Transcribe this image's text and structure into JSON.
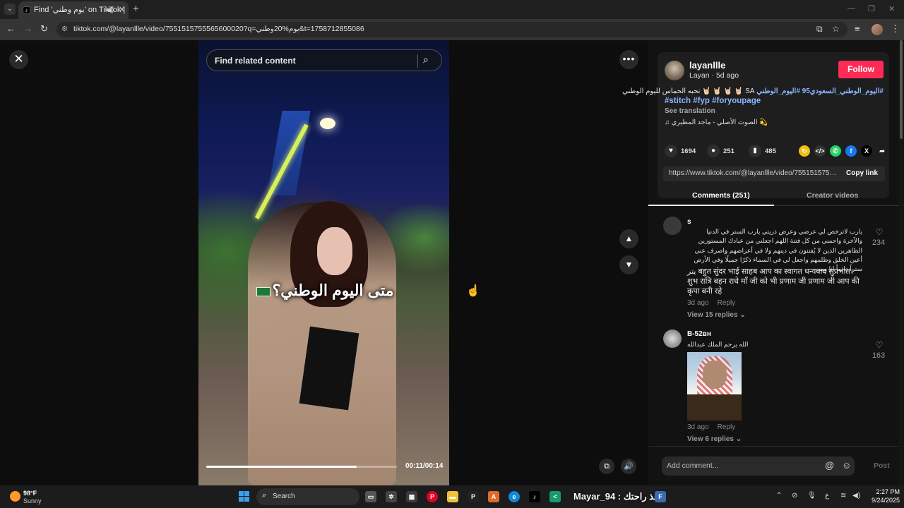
{
  "browser": {
    "tab_title": "Find 'يوم وطني' on TikTok |",
    "url": "tiktok.com/@layanllle/video/7551515755565600020?q=يوم%20وطني&t=1758712855086"
  },
  "video": {
    "search_placeholder": "Find related content",
    "caption": "متى اليوم الوطني؟",
    "time": "00:11/00:14",
    "progress_percent": 79
  },
  "author": {
    "username": "layanllle",
    "subline": "Layan · 5d ago",
    "follow_label": "Follow",
    "caption_tags": "#اليوم_الوطني_السعودي95 #اليوم_الوطني",
    "caption_text": "SA 🤘🏻 🤘🏻 🤘🏻 🤘🏻 تحبه الحماس لليوم الوطني",
    "hashtags": "#stitch #fyp #foryoupage",
    "see_translation": "See translation",
    "music": "♫  الصوت الأصلي - ماجد المطيري 💫"
  },
  "stats": {
    "likes": "1694",
    "comments": "251",
    "saves": "485"
  },
  "share": {
    "link": "https://www.tiktok.com/@layanllle/video/75515157555...",
    "copy_label": "Copy link"
  },
  "tabs": {
    "comments": "Comments (251)",
    "creator": "Creator videos"
  },
  "comments": [
    {
      "user": "s",
      "text_ar": "يارب لاترخص لي عرضي وعرض ذريتي يارب الستر في الدنيا والآخرة واحمني من كل فتنة اللهم اجعلني من عبادك المستورين الطاهرين الذين لا يُفتنون في دينهم ولا في أعراضهم واصرف عني أعين الخلق وظلمهم واجعل لي في السماء ذكرًا جميلًا وفي الأرض ستراً دائماً انا ومن",
      "text_hi": "يتر बहुत सुंदर भाई साहब आप का स्वागत धन्यवाद सुप्रभात। शुभ रात्रि बहन राधे माँ जी को भी प्रणाम जी प्रणाम जी आप की कृपा बनी रहे",
      "time": "3d ago",
      "reply": "Reply",
      "view_replies": "View 15 replies",
      "likes": "234"
    },
    {
      "user": "B-52ʙʜ",
      "text_ar": "الله يرحم الملك عبدالله بس",
      "time": "3d ago",
      "reply": "Reply",
      "view_replies": "View 6 replies",
      "likes": "163"
    }
  ],
  "comment_bar": {
    "placeholder": "Add comment...",
    "post": "Post"
  },
  "taskbar": {
    "temp": "98°F",
    "weather": "Sunny",
    "search": "Search",
    "overlay_text": "Mayar_94 : خذ راحتك",
    "time": "2:27 PM",
    "date": "9/24/2025"
  },
  "colors": {
    "follow": "#fe2c55",
    "hashtag": "#8ab4ff"
  }
}
